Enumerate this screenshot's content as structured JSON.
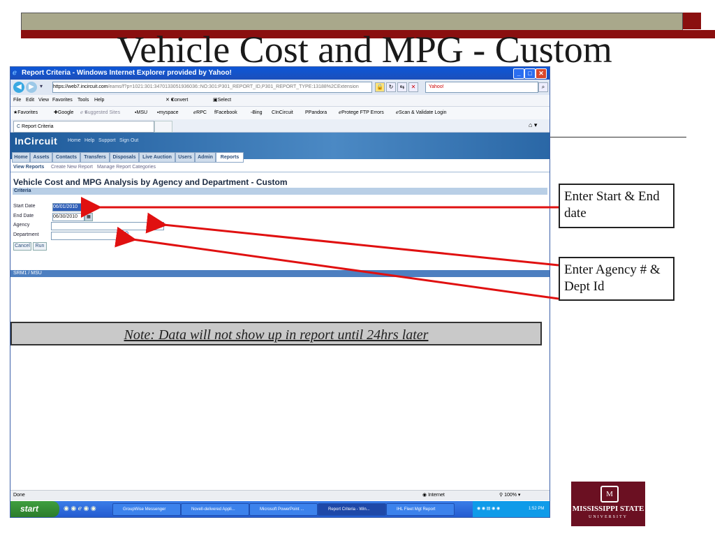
{
  "slide": {
    "title": "Vehicle Cost and MPG - Custom",
    "note": "Note:  Data will not show up in report until 24hrs later",
    "callouts": [
      "Enter Start & End date",
      "Enter Agency # & Dept Id"
    ],
    "logo_name": "MISSISSIPPI STATE",
    "logo_sub": "UNIVERSITY"
  },
  "browser": {
    "window_title": "Report Criteria - Windows Internet Explorer provided by Yahoo!",
    "address_host": "https://web7.incircuit.com",
    "address_rest": "/eams/f?p=1021:301:3470133051936036::NO:301:P301_REPORT_ID,P301_REPORT_TYPE:13188%2CExtension",
    "search_placeholder": "Yahoo!",
    "menu": [
      "File",
      "Edit",
      "View",
      "Favorites",
      "Tools",
      "Help"
    ],
    "convert": "Convert",
    "select": "Select",
    "favorites": [
      "Favorites",
      "Google",
      "Suggested Sites",
      "MSU",
      "myspace",
      "RPC",
      "Facebook",
      "Bing",
      "InCircuit",
      "Pandora",
      "Protege FTP Errors",
      "Scan & Validate Login"
    ],
    "tab": "Report Criteria",
    "status": "Done",
    "zone": "Internet",
    "zoom": "100%"
  },
  "app": {
    "logo": "InCircuit",
    "header_links": [
      "Home",
      "Help",
      "Support",
      "Sign Out"
    ],
    "tabs": [
      "Home",
      "Assets",
      "Contacts",
      "Transfers",
      "Disposals",
      "Live Auction",
      "Users",
      "Admin",
      "Reports"
    ],
    "subtabs": [
      "View Reports",
      "Create New Report",
      "Manage Report Categories"
    ],
    "report_title": "Vehicle Cost and MPG Analysis by Agency and Department - Custom",
    "criteria_label": "Criteria",
    "start_label": "Start Date",
    "start_value": "06/01/2010",
    "end_label": "End Date",
    "end_value": "06/30/2010",
    "agency_label": "Agency",
    "department_label": "Department",
    "cancel": "Cancel",
    "run": "Run",
    "footer": "SRM1 / MSU"
  },
  "taskbar": {
    "start": "start",
    "items": [
      "GroupWise Messenger",
      "Novell-delivered Appli...",
      "Microsoft PowerPoint ...",
      "Report Criteria - Win...",
      "IHL Fleet Mgt Report"
    ],
    "clock": "1:52 PM"
  },
  "colors": {
    "accent": "#8a0f0f",
    "arrow": "#e01010",
    "titlebar": "#0d57d8"
  }
}
